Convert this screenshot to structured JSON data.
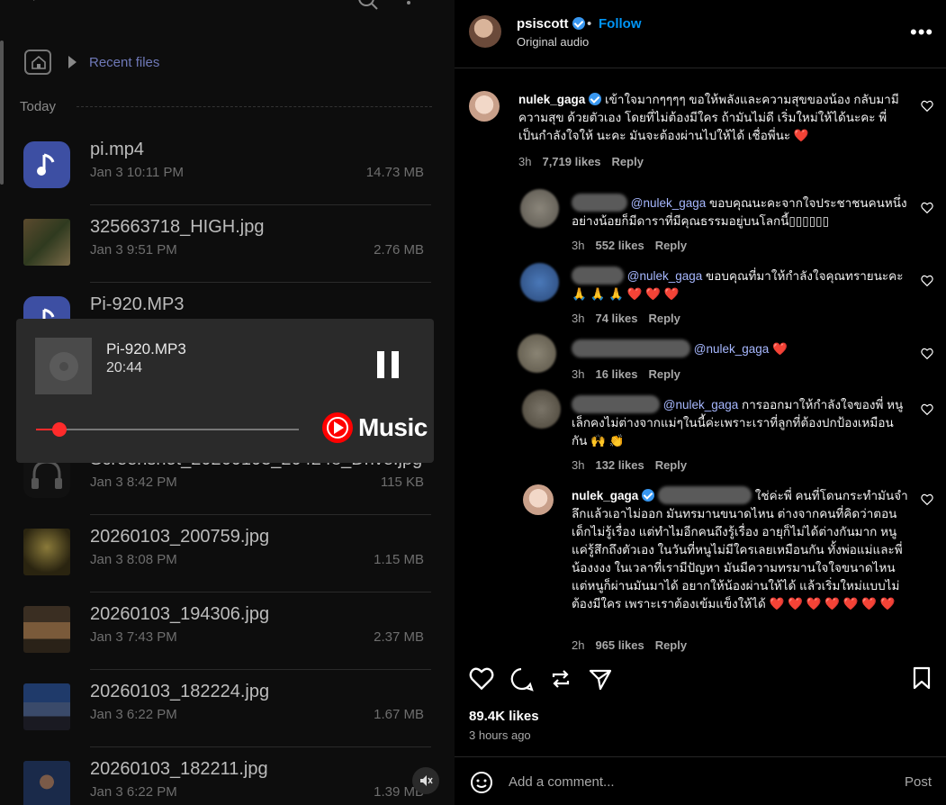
{
  "file_manager": {
    "breadcrumb": "Recent files",
    "section": "Today",
    "files": [
      {
        "name": "pi.mp4",
        "date": "Jan 3 10:11 PM",
        "size": "14.73 MB",
        "thumb": "music"
      },
      {
        "name": "325663718_HIGH.jpg",
        "date": "Jan 3 9:51 PM",
        "size": "2.76 MB",
        "thumb": "photo"
      },
      {
        "name": "Pi-920.MP3",
        "date": "",
        "size": "",
        "thumb": "music"
      },
      {
        "name": "Screenshot_20260103_204248_Drive.jpg",
        "date": "Jan 3 8:42 PM",
        "size": "115 KB",
        "thumb": "headphones"
      },
      {
        "name": "20260103_200759.jpg",
        "date": "Jan 3 8:08 PM",
        "size": "1.15 MB",
        "thumb": "photo"
      },
      {
        "name": "20260103_194306.jpg",
        "date": "Jan 3 7:43 PM",
        "size": "2.37 MB",
        "thumb": "photo"
      },
      {
        "name": "20260103_182224.jpg",
        "date": "Jan 3 6:22 PM",
        "size": "1.67 MB",
        "thumb": "photo"
      },
      {
        "name": "20260103_182211.jpg",
        "date": "Jan 3 6:22 PM",
        "size": "1.39 MB",
        "thumb": "photo"
      }
    ]
  },
  "player": {
    "title": "Pi-920.MP3",
    "time": "20:44",
    "progress": 0.09,
    "brand": "Music"
  },
  "post": {
    "username": "psiscott",
    "separator": "•",
    "follow": "Follow",
    "subtitle": "Original audio",
    "more": "•••"
  },
  "comments": [
    {
      "user": "nulek_gaga",
      "text": "เข้าใจมากๆๆๆๆ ขอให้พลังและความสุขของน้อง กลับมามีความสุข ด้วยตัวเอง โดยที่ไม่ต้องมีใคร ถ้ามันไม่ดี เริ่มใหม่ให้ได้นะคะ พี่เป็นกำลังใจให้ นะคะ มันจะต้องผ่านไปให้ได้ เชื่อพี่นะ ❤️",
      "time": "3h",
      "likes": "7,719 likes",
      "reply": "Reply"
    },
    {
      "mention": "@nulek_gaga",
      "text": " ขอบคุณนะคะจากใจประชาชนคนหนึ่ง อย่างน้อยก็มีดาราที่มีคุณธรรมอยู่บนโลกนี้▯▯▯▯▯▯",
      "time": "3h",
      "likes": "552 likes",
      "reply": "Reply"
    },
    {
      "mention": "@nulek_gaga",
      "text": " ขอบคุณที่มาให้กำลังใจคุณทรายนะคะ🙏 🙏 🙏 ❤️ ❤️ ❤️",
      "time": "3h",
      "likes": "74 likes",
      "reply": "Reply"
    },
    {
      "mention": "@nulek_gaga",
      "text": " ❤️",
      "time": "3h",
      "likes": "16 likes",
      "reply": "Reply"
    },
    {
      "mention": "@nulek_gaga",
      "text": " การออกมาให้กำลังใจของพี่ หนูเล็กคงไม่ต่างจากแม่ๆในนี้ค่ะเพราะเราที่ลูกที่ต้องปกป้องเหมือนกัน 🙌 👏",
      "time": "3h",
      "likes": "132 likes",
      "reply": "Reply"
    },
    {
      "user": "nulek_gaga",
      "text": "ใช่ค่ะพี่ คนที่โดนกระทำมันจำลึกแล้วเอาไม่ออก มันทรมานขนาดไหน ต่างจากคนที่คิดว่าตอนเด็กไม่รู้เรื่อง แต่ทำไมอีกคนถึงรู้เรื่อง อายุก็ไม่ได้ต่างกันมาก หนูแค่รู้สึกถึงตัวเอง ในวันที่หนูไม่มีใครเลยเหมือนกัน ทั้งพ่อแม่และพี่น้องงงง ในเวลาที่เรามีปัญหา มันมีความทรมานใจใจขนาดไหน แต่หนูก็ผ่านมันมาได้ อยากให้น้องผ่านให้ได้ แล้วเริ่มใหม่แบบไม่ต้องมีใคร เพราะเราต้องเข้มแข็งให้ได้ ❤️ ❤️ ❤️ ❤️ ❤️ ❤️ ❤️",
      "time": "2h",
      "likes": "965 likes",
      "reply": "Reply"
    }
  ],
  "footer": {
    "likes": "89.4K likes",
    "ago": "3 hours ago",
    "add_placeholder": "Add a comment...",
    "post": "Post"
  },
  "colors": {
    "accent": "#0095f6",
    "verified": "#3897f0",
    "youtube_red": "#ff0000",
    "music_thumb": "#3d4fa3"
  }
}
